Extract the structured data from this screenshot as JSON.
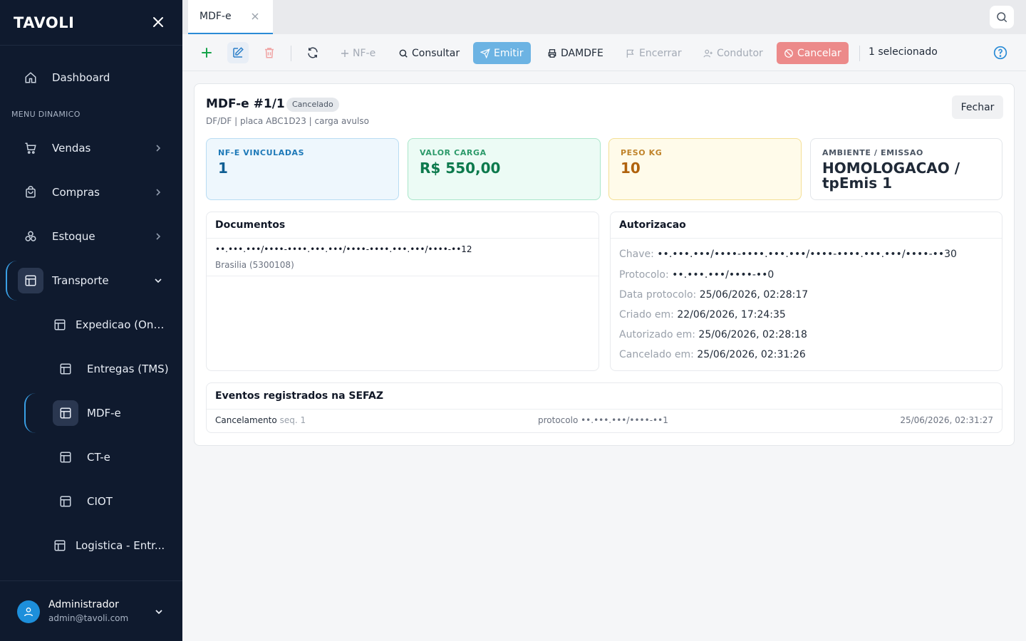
{
  "app": {
    "logo": "TAVOLI"
  },
  "sidebar": {
    "dashboard": "Dashboard",
    "section_label": "MENU DINAMICO",
    "items": [
      {
        "label": "Vendas",
        "icon": "cart-icon"
      },
      {
        "label": "Compras",
        "icon": "bag-icon"
      },
      {
        "label": "Estoque",
        "icon": "boxes-icon"
      },
      {
        "label": "Transporte",
        "icon": "layout-icon"
      }
    ],
    "subitems": [
      {
        "label": "Expedicao (Ond..."
      },
      {
        "label": "Entregas (TMS)"
      },
      {
        "label": "MDF-e"
      },
      {
        "label": "CT-e"
      },
      {
        "label": "CIOT"
      },
      {
        "label": "Logistica - Entr..."
      }
    ],
    "user": {
      "name": "Administrador",
      "email": "admin@tavoli.com"
    }
  },
  "tabs": [
    {
      "label": "MDF-e"
    }
  ],
  "toolbar": {
    "nfe": "NF-e",
    "consultar": "Consultar",
    "emitir": "Emitir",
    "damdfe": "DAMDFE",
    "encerrar": "Encerrar",
    "condutor": "Condutor",
    "cancelar": "Cancelar",
    "selection": "1 selecionado"
  },
  "record": {
    "title": "MDF-e #1/1",
    "status": "Cancelado",
    "subtitle": "DF/DF | placa ABC1D23 | carga avulso",
    "close_label": "Fechar"
  },
  "stats": {
    "nfe": {
      "label": "NF-E VINCULADAS",
      "value": "1"
    },
    "carga": {
      "label": "VALOR CARGA",
      "value": "R$ 550,00"
    },
    "peso": {
      "label": "PESO KG",
      "value": "10"
    },
    "ambiente": {
      "label": "AMBIENTE / EMISSAO",
      "value": "HOMOLOGACAO / tpEmis 1"
    }
  },
  "documentos": {
    "title": "Documentos",
    "rows": [
      {
        "key": "••.•••.•••/••••-••••.•••.•••/••••-••••.•••.•••/••••-••12",
        "city": "Brasilia (5300108)"
      }
    ]
  },
  "autorizacao": {
    "title": "Autorizacao",
    "lines": [
      {
        "label": "Chave:",
        "value": "••.•••.•••/••••-••••.•••.•••/••••-••••.•••.•••/••••-••30"
      },
      {
        "label": "Protocolo:",
        "value": "••.•••.•••/••••-••0"
      },
      {
        "label": "Data protocolo:",
        "value": "25/06/2026, 02:28:17"
      },
      {
        "label": "Criado em:",
        "value": "22/06/2026, 17:24:35"
      },
      {
        "label": "Autorizado em:",
        "value": "25/06/2026, 02:28:18"
      },
      {
        "label": "Cancelado em:",
        "value": "25/06/2026, 02:31:26"
      }
    ]
  },
  "eventos": {
    "title": "Eventos registrados na SEFAZ",
    "rows": [
      {
        "type": "Cancelamento",
        "seq": "seq. 1",
        "protocol": "protocolo ••.•••.•••/••••-••1",
        "date": "25/06/2026, 02:31:27"
      }
    ]
  },
  "colors": {
    "sidebar_bg": "#0f1a2e",
    "accent": "#2a8bd6",
    "emit": "#6cb3e3",
    "cancel": "#ec8a8a",
    "add": "#16a34a",
    "delete": "#f0a4a4"
  }
}
